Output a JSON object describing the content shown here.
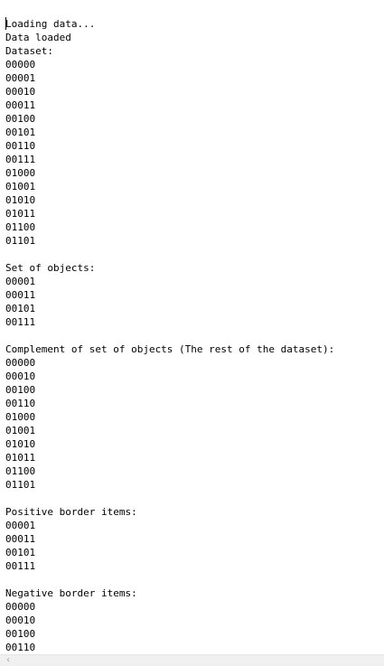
{
  "console": {
    "lines": [
      "Loading data...",
      "Data loaded",
      "Dataset:",
      "00000",
      "00001",
      "00010",
      "00011",
      "00100",
      "00101",
      "00110",
      "00111",
      "01000",
      "01001",
      "01010",
      "01011",
      "01100",
      "01101",
      "",
      "Set of objects:",
      "00001",
      "00011",
      "00101",
      "00111",
      "",
      "Complement of set of objects (The rest of the dataset):",
      "00000",
      "00010",
      "00100",
      "00110",
      "01000",
      "01001",
      "01010",
      "01011",
      "01100",
      "01101",
      "",
      "Positive border items:",
      "00001",
      "00011",
      "00101",
      "00111",
      "",
      "Negative border items:",
      "00000",
      "00010",
      "00100",
      "00110"
    ]
  },
  "scrollbar": {
    "left_arrow_glyph": "‹",
    "left_arrow_icon": "chevron-left-icon"
  },
  "colors": {
    "text": "#000000",
    "background": "#ffffff",
    "scrollbar_track": "#f0f0f0",
    "scrollbar_arrow": "#a3a3a3"
  }
}
